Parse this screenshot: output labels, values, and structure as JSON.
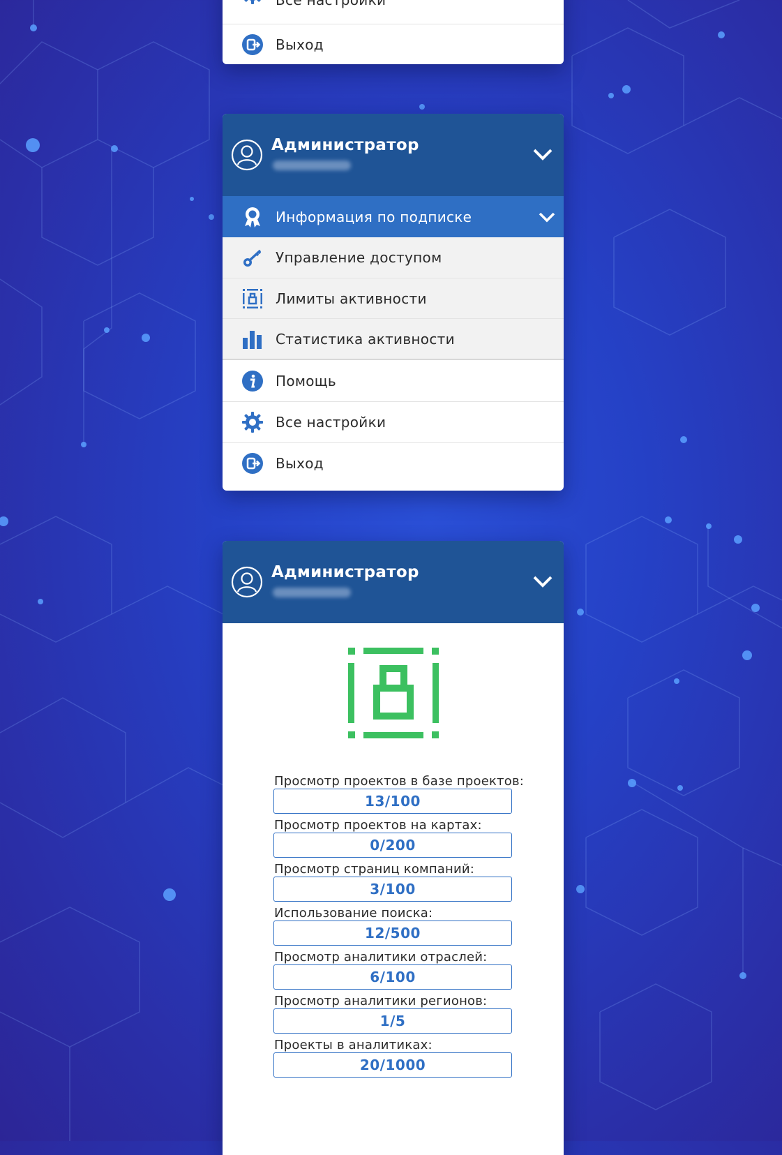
{
  "menu_top": {
    "items": [
      {
        "label": "Все настройки",
        "icon": "gear-icon"
      },
      {
        "label": "Выход",
        "icon": "logout-icon"
      }
    ]
  },
  "menu_expanded": {
    "header": {
      "title": "Администратор"
    },
    "active_item": {
      "label": "Информация по подписке",
      "icon": "award-icon"
    },
    "sub_items": [
      {
        "label": "Управление доступом",
        "icon": "key-icon"
      },
      {
        "label": "Лимиты активности",
        "icon": "limit-lock-icon"
      },
      {
        "label": "Статистика активности",
        "icon": "bar-chart-icon"
      }
    ],
    "items": [
      {
        "label": "Помощь",
        "icon": "info-icon"
      },
      {
        "label": "Все настройки",
        "icon": "gear-icon"
      },
      {
        "label": "Выход",
        "icon": "logout-icon"
      }
    ]
  },
  "limits_panel": {
    "header": {
      "title": "Администратор"
    },
    "icon": "limit-lock-icon",
    "limits": [
      {
        "label": "Просмотр проектов в базе проектов:",
        "value": "13/100"
      },
      {
        "label": "Просмотр проектов на картах:",
        "value": "0/200"
      },
      {
        "label": "Просмотр страниц компаний:",
        "value": "3/100"
      },
      {
        "label": "Использование поиска:",
        "value": "12/500"
      },
      {
        "label": "Просмотр аналитики отраслей:",
        "value": "6/100"
      },
      {
        "label": "Просмотр аналитики регионов:",
        "value": "1/5"
      },
      {
        "label": "Проекты в аналитиках:",
        "value": "20/1000"
      }
    ]
  },
  "colors": {
    "header_bg": "#1f5496",
    "active_bg": "#2f6fc4",
    "accent": "#2f6fc4",
    "limit_icon": "#3cc060"
  }
}
